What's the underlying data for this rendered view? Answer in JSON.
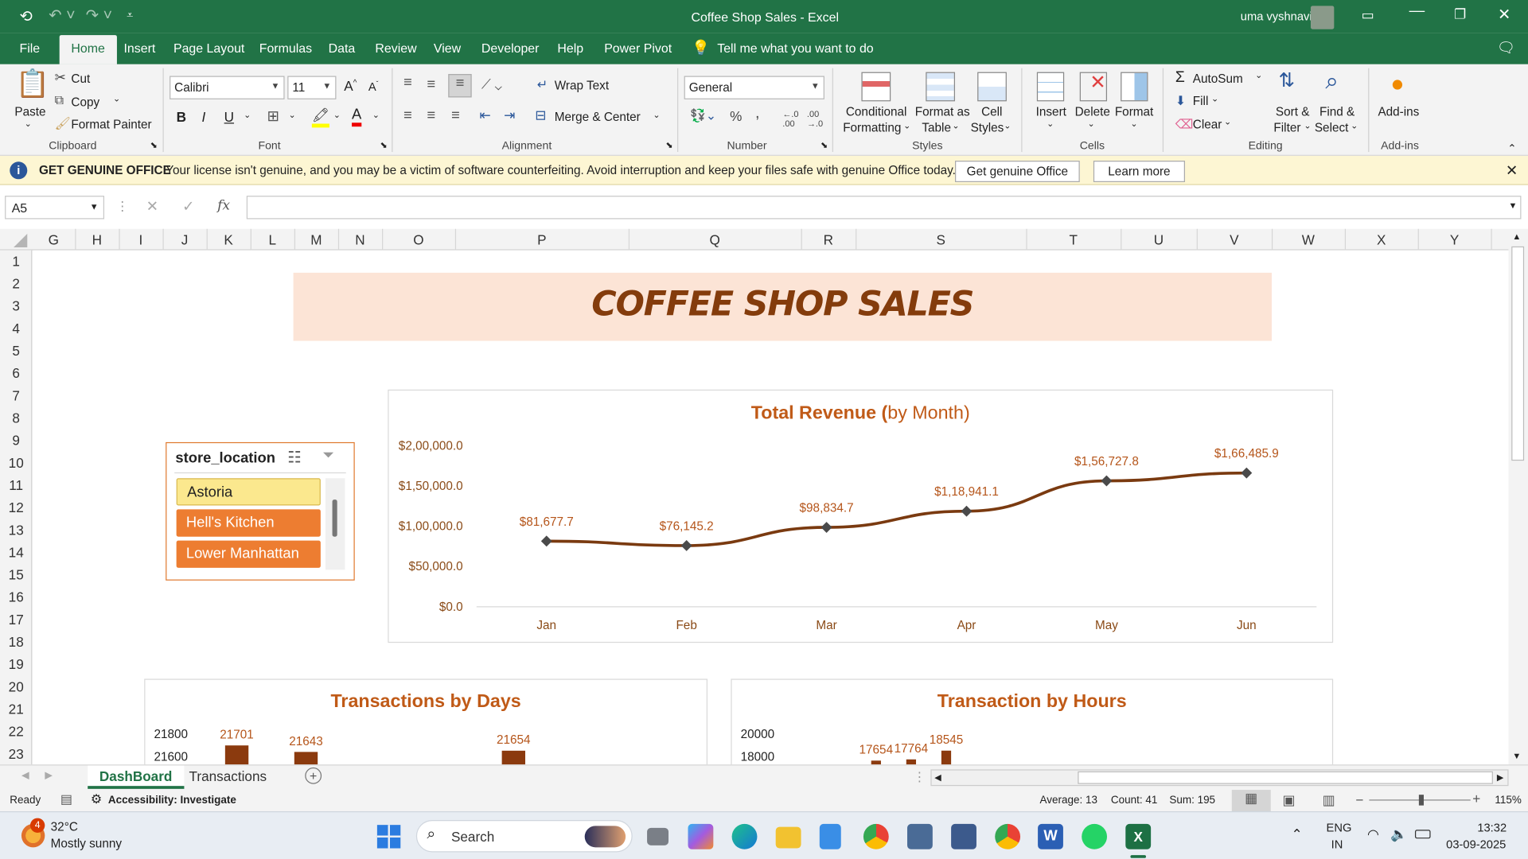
{
  "window": {
    "title": "Coffee Shop Sales  -  Excel",
    "user": "uma vyshnavi"
  },
  "menu": {
    "items": [
      "File",
      "Home",
      "Insert",
      "Page Layout",
      "Formulas",
      "Data",
      "Review",
      "View",
      "Developer",
      "Help",
      "Power Pivot"
    ],
    "tell_me": "Tell me what you want to do"
  },
  "ribbon": {
    "clipboard": {
      "paste": "Paste",
      "cut": "Cut",
      "copy": "Copy",
      "format_painter": "Format Painter",
      "label": "Clipboard"
    },
    "font": {
      "name": "Calibri",
      "size": "11",
      "label": "Font"
    },
    "alignment": {
      "wrap": "Wrap Text",
      "merge": "Merge & Center",
      "label": "Alignment"
    },
    "number": {
      "format": "General",
      "label": "Number"
    },
    "styles": {
      "conditional": "Conditional",
      "conditional2": "Formatting",
      "format_as": "Format as",
      "format_as2": "Table",
      "cell": "Cell",
      "cell2": "Styles",
      "label": "Styles"
    },
    "cells": {
      "insert": "Insert",
      "delete": "Delete",
      "format": "Format",
      "label": "Cells"
    },
    "editing": {
      "autosum": "AutoSum",
      "fill": "Fill",
      "clear": "Clear",
      "sort": "Sort &",
      "sort2": "Filter",
      "find": "Find &",
      "find2": "Select",
      "label": "Editing"
    },
    "addins": {
      "addins": "Add-ins",
      "label": "Add-ins"
    }
  },
  "message_bar": {
    "title": "GET GENUINE OFFICE",
    "text": "Your license isn't genuine, and you may be a victim of software counterfeiting. Avoid interruption and keep your files safe with genuine Office today.",
    "btn1": "Get genuine Office",
    "btn2": "Learn more"
  },
  "formula_bar": {
    "name_box": "A5",
    "value": ""
  },
  "columns": [
    "G",
    "H",
    "I",
    "J",
    "K",
    "L",
    "M",
    "N",
    "O",
    "P",
    "Q",
    "R",
    "S",
    "T",
    "U",
    "V",
    "W",
    "X",
    "Y"
  ],
  "rows": [
    "1",
    "2",
    "3",
    "4",
    "5",
    "6",
    "7",
    "8",
    "9",
    "10",
    "11",
    "12",
    "13",
    "14",
    "15",
    "16",
    "17",
    "18",
    "19",
    "20",
    "21",
    "22",
    "23"
  ],
  "dashboard": {
    "title": "COFFEE SHOP SALES",
    "slicer": {
      "header": "store_location",
      "items": [
        "Astoria",
        "Hell's Kitchen",
        "Lower Manhattan"
      ]
    },
    "chart_titles": {
      "revenue_bold": "Total Revenue (",
      "revenue_rest": "by Month)",
      "days": "Transactions by Days",
      "hours": "Transaction by Hours"
    }
  },
  "chart_data": [
    {
      "type": "line",
      "title": "Total Revenue (by Month)",
      "categories": [
        "Jan",
        "Feb",
        "Mar",
        "Apr",
        "May",
        "Jun"
      ],
      "values": [
        81677.7,
        76145.2,
        98834.7,
        118941.1,
        156727.8,
        166485.9
      ],
      "labels": [
        "$81,677.7",
        "$76,145.2",
        "$98,834.7",
        "$1,18,941.1",
        "$1,56,727.8",
        "$1,66,485.9"
      ],
      "y_ticks": [
        "$0.0",
        "$50,000.0",
        "$1,00,000.0",
        "$1,50,000.0",
        "$2,00,000.0"
      ],
      "ylim": [
        0,
        200000
      ],
      "color": "#7a3a10"
    },
    {
      "type": "bar",
      "title": "Transactions by Days",
      "values": [
        21701,
        21643,
        21654
      ],
      "y_ticks": [
        "21600",
        "21800"
      ],
      "color": "#8b3a0e"
    },
    {
      "type": "bar",
      "title": "Transaction by Hours",
      "values": [
        17654,
        17764,
        18545
      ],
      "y_ticks": [
        "18000",
        "20000"
      ],
      "color": "#8b3a0e"
    }
  ],
  "sheet_tabs": [
    "DashBoard",
    "Transactions"
  ],
  "status": {
    "ready": "Ready",
    "accessibility": "Accessibility: Investigate",
    "average": "Average: 13",
    "count": "Count: 41",
    "sum": "Sum: 195",
    "zoom": "115%"
  },
  "taskbar": {
    "temp": "32°C",
    "weather": "Mostly sunny",
    "badge": "4",
    "search": "Search",
    "lang1": "ENG",
    "lang2": "IN",
    "time": "13:32",
    "date": "03-09-2025"
  }
}
